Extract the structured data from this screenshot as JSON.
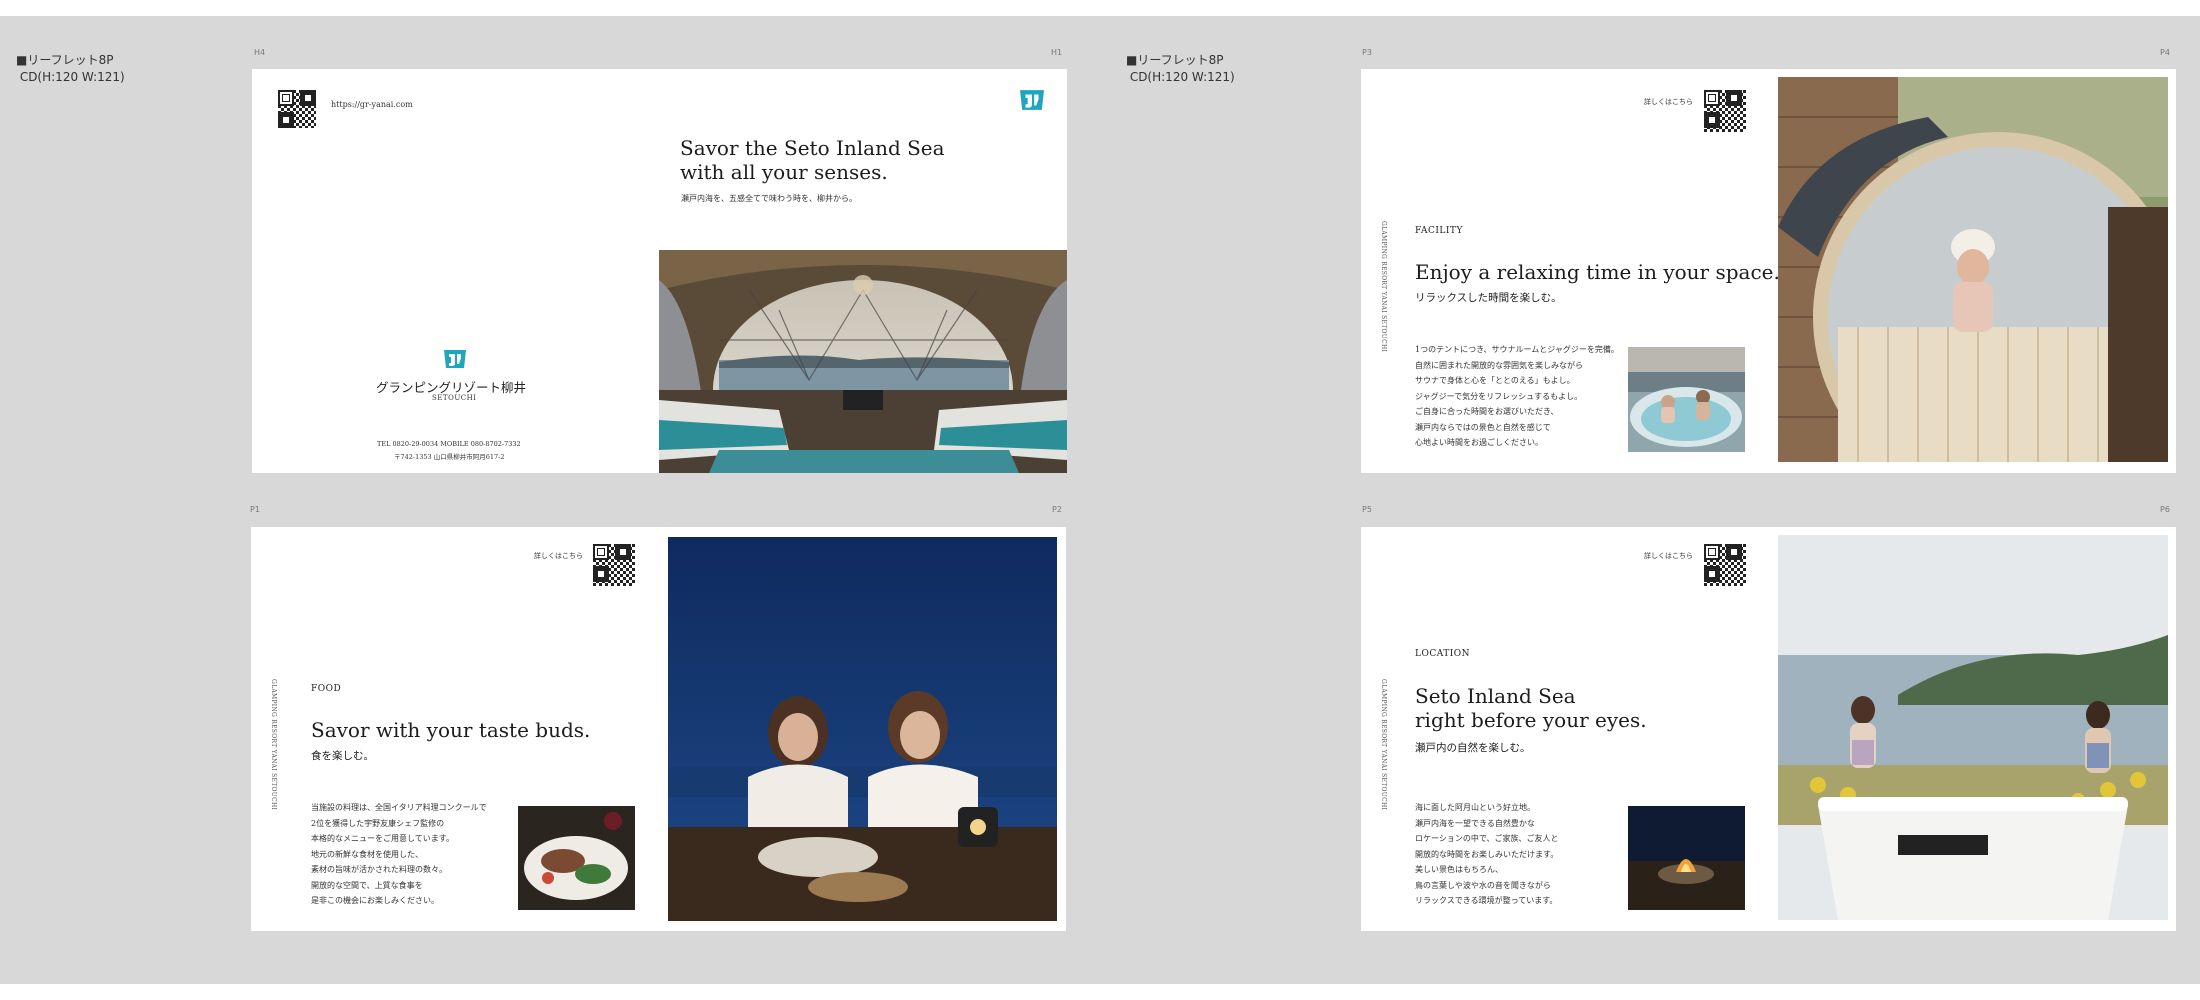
{
  "specs": {
    "left": "■リーフレット8P\n CD(H:120 W:121)",
    "right": "■リーフレット8P\n CD(H:120 W:121)"
  },
  "page_numbers": {
    "spread1_left": "H4",
    "spread1_right": "H1",
    "spread2_left": "P3",
    "spread2_right": "P4",
    "spread3_left": "P1",
    "spread3_right": "P2",
    "spread4_left": "P5",
    "spread4_right": "P6"
  },
  "cover_back": {
    "url": "https://gr-yanai.com",
    "brand_name": "グランピングリゾート柳井",
    "brand_sub": "SETOUCHI",
    "tel_line": "TEL 0820-29-0034  MOBILE 080-8702-7332",
    "address_line": "〒742-1353 山口県柳井市阿月617-2"
  },
  "cover_front": {
    "title_line1": "Savor the Seto Inland Sea",
    "title_line2": "with all your senses.",
    "subtitle": "瀬戸内海を、五感全てで味わう時を、柳井から。"
  },
  "facility": {
    "qr_label": "詳しくはこちら",
    "vertical_text": "GLAMPING RESORT YANAI SETOUCHI",
    "label": "FACILITY",
    "heading": "Enjoy a relaxing time in your space.",
    "heading_jp": "リラックスした時間を楽しむ。",
    "body": [
      "1つのテントにつき、サウナルームとジャグジーを完備。",
      "自然に囲まれた開放的な雰囲気を楽しみながら",
      "サウナで身体と心を「ととのえる」もよし。",
      "ジャグジーで気分をリフレッシュするもよし。",
      "ご自身に合った時間をお選びいただき、",
      "瀬戸内ならではの景色と自然を感じて",
      "心地よい時間をお過ごしください。"
    ]
  },
  "food": {
    "qr_label": "詳しくはこちら",
    "vertical_text": "GLAMPING RESORT YANAI SETOUCHI",
    "label": "FOOD",
    "heading": "Savor with your taste buds.",
    "heading_jp": "食を楽しむ。",
    "body": [
      "当施設の料理は、全国イタリア料理コンクールで",
      "2位を獲得した宇野友康シェフ監修の",
      "本格的なメニューをご用意しています。",
      "地元の新鮮な食材を使用した、",
      "素材の旨味が活かされた料理の数々。",
      "開放的な空間で、上質な食事を",
      "是非この機会にお楽しみください。"
    ]
  },
  "location": {
    "qr_label": "詳しくはこちら",
    "vertical_text": "GLAMPING RESORT YANAI SETOUCHI",
    "label": "LOCATION",
    "heading_line1": "Seto Inland Sea",
    "heading_line2": "right before your eyes.",
    "heading_jp": "瀬戸内の自然を楽しむ。",
    "body": [
      "海に面した阿月山という好立地。",
      "瀬戸内海を一望できる自然豊かな",
      "ロケーションの中で、ご家族、ご友人と",
      "開放的な時間をお楽しみいただけます。",
      "美しい景色はもちろん、",
      "鳥の言葉しや波や水の音を聞きながら",
      "リラックスできる環境が整っています。"
    ]
  },
  "colors": {
    "brand_teal": "#1fa6bf",
    "board_gray": "#d7d8d7"
  }
}
